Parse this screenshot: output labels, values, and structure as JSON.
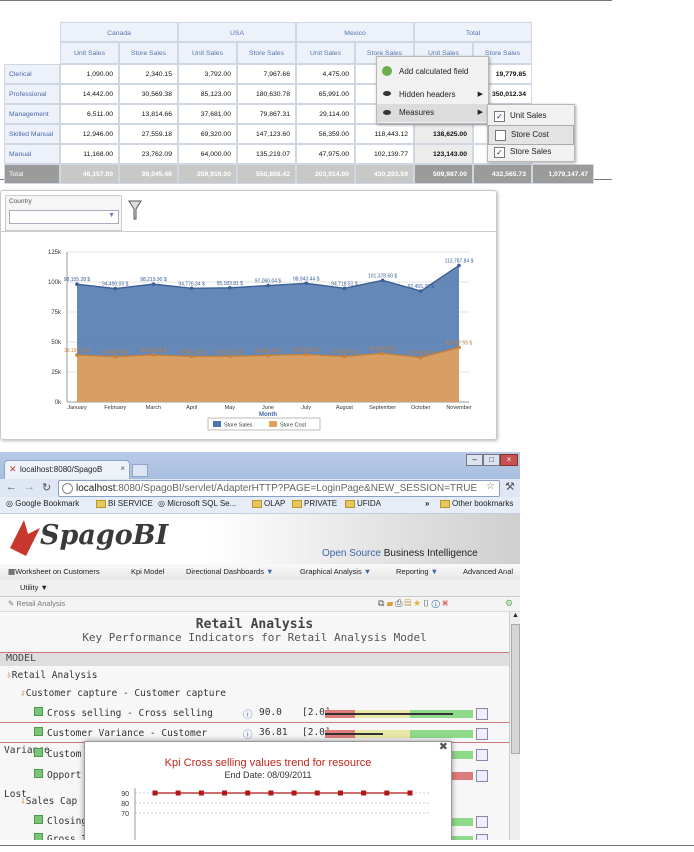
{
  "pivot": {
    "countries": [
      "Canada",
      "USA",
      "Mexico",
      "Total"
    ],
    "measure_headers": [
      "Unit Sales",
      "Store Sales",
      "Unit Sales",
      "Store Sales",
      "Unit Sales",
      "Store Sales",
      "Unit Sales",
      "Store Sales"
    ],
    "rows": [
      {
        "label": "Clerical",
        "values": [
          "1,090.00",
          "2,340.15",
          "3,792.00",
          "7,967.66",
          "4,475.00",
          "",
          "",
          "19,779.85"
        ]
      },
      {
        "label": "Professional",
        "values": [
          "14,442.00",
          "30,569.38",
          "85,123.00",
          "180,630.78",
          "65,991.00",
          "",
          "",
          "350,012.34"
        ]
      },
      {
        "label": "Management",
        "values": [
          "6,511.00",
          "13,814.66",
          "37,681.00",
          "79,867.31",
          "29,114.00",
          "",
          "",
          ""
        ]
      },
      {
        "label": "Skilled Manual",
        "values": [
          "12,946.00",
          "27,559.18",
          "69,320.00",
          "147,123.60",
          "56,359.00",
          "118,443.12",
          "138,625.00",
          ""
        ]
      },
      {
        "label": "Manual",
        "values": [
          "11,168.00",
          "23,762.09",
          "64,000.00",
          "135,219.07",
          "47,975.00",
          "102,139.77",
          "123,143.00",
          ""
        ]
      },
      {
        "label": "Total",
        "values": [
          "46,157.00",
          "98,045.46",
          "259,916.00",
          "550,808.42",
          "203,914.00",
          "430,293.59",
          "509,987.00",
          "432,565.73"
        ]
      }
    ],
    "extra_total": "1,079,147.47",
    "menu": {
      "add_calc": "Add calculated field",
      "hidden_headers": "Hidden headers",
      "measures": "Measures"
    },
    "submenu": [
      {
        "label": "Unit Sales",
        "checked": true
      },
      {
        "label": "Store Cost",
        "checked": false
      },
      {
        "label": "Store Sales",
        "checked": true
      }
    ]
  },
  "filter": {
    "label": "Country"
  },
  "chart_data": {
    "type": "area",
    "categories": [
      "January",
      "February",
      "March",
      "April",
      "May",
      "June",
      "July",
      "August",
      "September",
      "October",
      "November"
    ],
    "xlabel": "Month",
    "ylabel": "",
    "ylim": [
      0,
      125000
    ],
    "yticks": [
      "0k",
      "25k",
      "50k",
      "75k",
      "100k",
      "125k"
    ],
    "series": [
      {
        "name": "Store Sales",
        "color": "#4f77ad",
        "values": [
          98155.28,
          94490.0,
          98219.9,
          94776.34,
          95183.81,
          97060.04,
          98943.44,
          94718.51,
          101378.6,
          92455.76,
          113787.84
        ],
        "labels": [
          "98,155.28 $",
          "94,490.00 $",
          "98,219.90 $",
          "94,776.34 $",
          "95,183.81 $",
          "97,060.04 $",
          "98,943.44 $",
          "94,718.51 $",
          "101,378.60 $",
          "92,455.76 $",
          "113,787.84 $"
        ]
      },
      {
        "name": "Store Cost",
        "color": "#e1a15c",
        "values": [
          39193.11,
          37841.0,
          39338.36,
          37947.12,
          38117.51,
          38866.4,
          39618.53,
          37933.5,
          40609.66,
          37016.84,
          45567.55
        ],
        "labels": [
          "39,193.11 $",
          "37,841.00 $",
          "39,338.36 $",
          "37,947.12 $",
          "38,117.51 $",
          "38,866.40 $",
          "39,618.53 $",
          "37,933.50 $",
          "40,609.66 $",
          "37,016.84 $",
          "45,567.55 $"
        ]
      }
    ],
    "legend": [
      "Store Sales",
      "Store Cost"
    ]
  },
  "browser": {
    "tab_title": "localhost:8080/SpagoB",
    "url_host": "localhost",
    "url_rest": ":8080/SpagoBI/servlet/AdapterHTTP?PAGE=LoginPage&NEW_SESSION=TRUE",
    "bookmarks": [
      "Google Bookmark",
      "BI SERVICE",
      "Microsoft SQL Se...",
      "OLAP",
      "PRIVATE",
      "UFIDA"
    ],
    "other_bookmarks": "Other bookmarks",
    "logo": "SpagoBI",
    "tagline_a": "Open Source ",
    "tagline_b": "Business Intelligence",
    "menu": [
      "Worksheet on Customers",
      "Kpi Model",
      "Directional Dashboards",
      "Graphical Analysis",
      "Reporting",
      "Advanced Anal"
    ],
    "menu2": "Utility",
    "crumb": "Retail Analysis",
    "kpi": {
      "title": "Retail Analysis",
      "subtitle": "Key Performance Indicators for Retail Analysis Model",
      "model_label": "MODEL",
      "rows": [
        {
          "label": "Retail Analysis",
          "value": "",
          "weight": ""
        },
        {
          "label": "Customer capture - Customer capture",
          "value": "",
          "weight": ""
        },
        {
          "label": "Cross selling - Cross selling",
          "value": "90.0",
          "weight": "[2.0]"
        },
        {
          "label": "Customer Variance - Customer",
          "value": "36.81",
          "weight": "[2.0]"
        },
        {
          "label": "Variance",
          "value": "",
          "weight": ""
        },
        {
          "label": "Custom",
          "value": "",
          "weight": ""
        },
        {
          "label": "Opport",
          "value": "",
          "weight": ""
        },
        {
          "label": "Lost",
          "value": "",
          "weight": ""
        },
        {
          "label": "Sales Cap",
          "value": "",
          "weight": ""
        },
        {
          "label": "Closing",
          "value": "",
          "weight": ""
        },
        {
          "label": "Gross I",
          "value": "",
          "weight": ""
        }
      ]
    },
    "popup": {
      "title": "Kpi Cross selling values trend for resource",
      "end_date": "End Date: 08/09/2011",
      "yticks": [
        "90",
        "80",
        "70"
      ],
      "values": [
        90,
        90,
        90,
        90,
        90,
        90,
        90,
        90,
        90,
        90,
        90,
        90
      ]
    }
  }
}
